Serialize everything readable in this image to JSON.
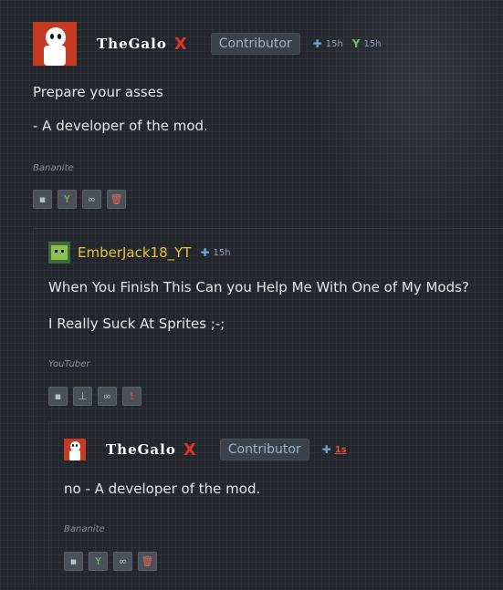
{
  "comments": [
    {
      "username": "TheGalo",
      "username_mark": "X",
      "role": "Contributor",
      "time": "15h",
      "fork_time": "15h",
      "lines": [
        "Prepare your asses",
        "- A developer of the mod."
      ],
      "signature": "Bananite",
      "actions": [
        "reply-icon",
        "endorse-icon",
        "link-icon",
        "delete-icon"
      ]
    },
    {
      "username": "EmberJack18_YT",
      "time": "15h",
      "lines": [
        "When You Finish This Can you Help Me With One of My Mods?",
        "I Really Suck At Sprites ;-;"
      ],
      "signature": "YouTuber",
      "actions": [
        "reply-icon",
        "stamp-icon",
        "link-icon",
        "report-icon"
      ]
    },
    {
      "username": "TheGalo",
      "username_mark": "X",
      "role": "Contributor",
      "time": "1s",
      "lines": [
        "no - A developer of the mod."
      ],
      "signature": "Bananite",
      "actions": [
        "reply-icon",
        "endorse-icon",
        "link-icon",
        "delete-icon"
      ]
    }
  ],
  "colors": {
    "background": "#23272d",
    "accent_blue": "#5fa8e0",
    "username_yellow": "#e8c23b",
    "logo_red": "#e0332c"
  }
}
